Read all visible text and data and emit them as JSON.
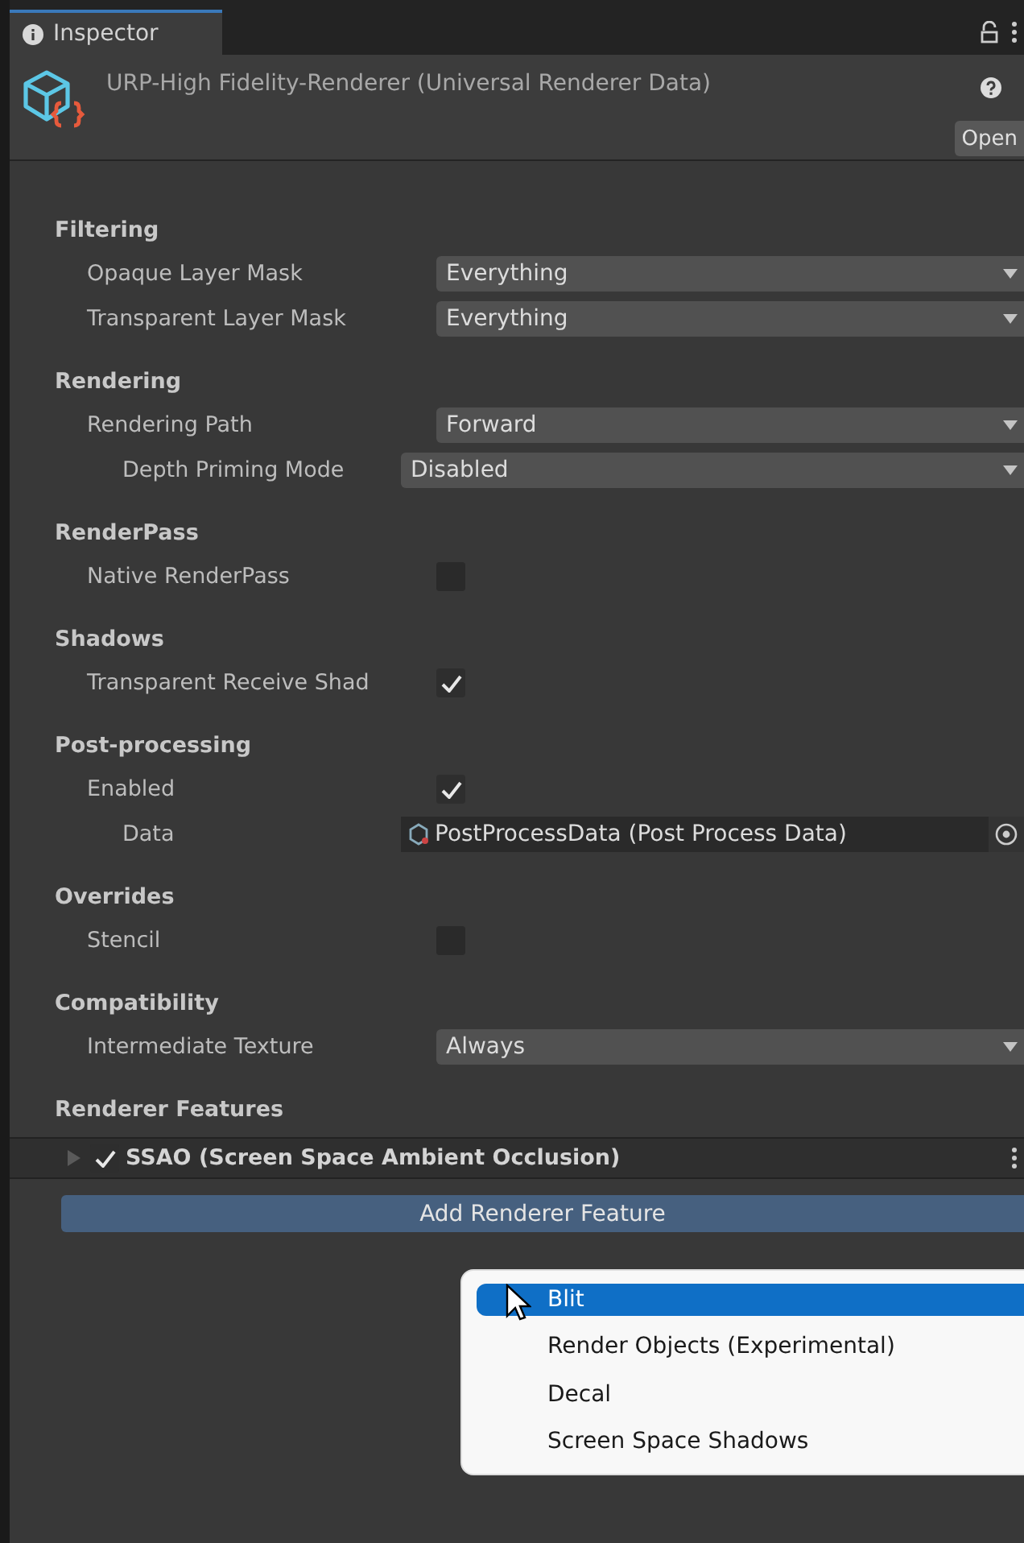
{
  "tab": {
    "label": "Inspector",
    "selected": true
  },
  "header": {
    "title": "URP-High Fidelity-Renderer (Universal Renderer Data)",
    "open_button": "Open"
  },
  "sections": [
    {
      "title": "Filtering",
      "fields": [
        {
          "label": "Opaque Layer Mask",
          "kind": "dropdown",
          "value": "Everything"
        },
        {
          "label": "Transparent Layer Mask",
          "kind": "dropdown",
          "value": "Everything"
        }
      ]
    },
    {
      "title": "Rendering",
      "fields": [
        {
          "label": "Rendering Path",
          "kind": "dropdown",
          "value": "Forward",
          "children": [
            {
              "label": "Depth Priming Mode",
              "kind": "dropdown",
              "value": "Disabled"
            }
          ]
        }
      ]
    },
    {
      "title": "RenderPass",
      "fields": [
        {
          "label": "Native RenderPass",
          "kind": "checkbox",
          "checked": false
        }
      ]
    },
    {
      "title": "Shadows",
      "fields": [
        {
          "label": "Transparent Receive Shad",
          "kind": "checkbox",
          "checked": true
        }
      ]
    },
    {
      "title": "Post-processing",
      "fields": [
        {
          "label": "Enabled",
          "kind": "checkbox",
          "checked": true,
          "children": [
            {
              "label": "Data",
              "kind": "object",
              "value": "PostProcessData (Post Process Data)"
            }
          ]
        }
      ]
    },
    {
      "title": "Overrides",
      "fields": [
        {
          "label": "Stencil",
          "kind": "checkbox",
          "checked": false
        }
      ]
    },
    {
      "title": "Compatibility",
      "fields": [
        {
          "label": "Intermediate Texture",
          "kind": "dropdown",
          "value": "Always"
        }
      ]
    }
  ],
  "renderer_features": {
    "title": "Renderer Features",
    "items": [
      {
        "label": "SSAO (Screen Space Ambient Occlusion)",
        "checked": true,
        "expanded": false
      }
    ],
    "add_button": "Add Renderer Feature"
  },
  "menu": [
    {
      "label": "Blit",
      "selected": true
    },
    {
      "label": "Render Objects (Experimental)",
      "selected": false
    },
    {
      "label": "Decal",
      "selected": false
    },
    {
      "label": "Screen Space Shadows",
      "selected": false
    }
  ]
}
